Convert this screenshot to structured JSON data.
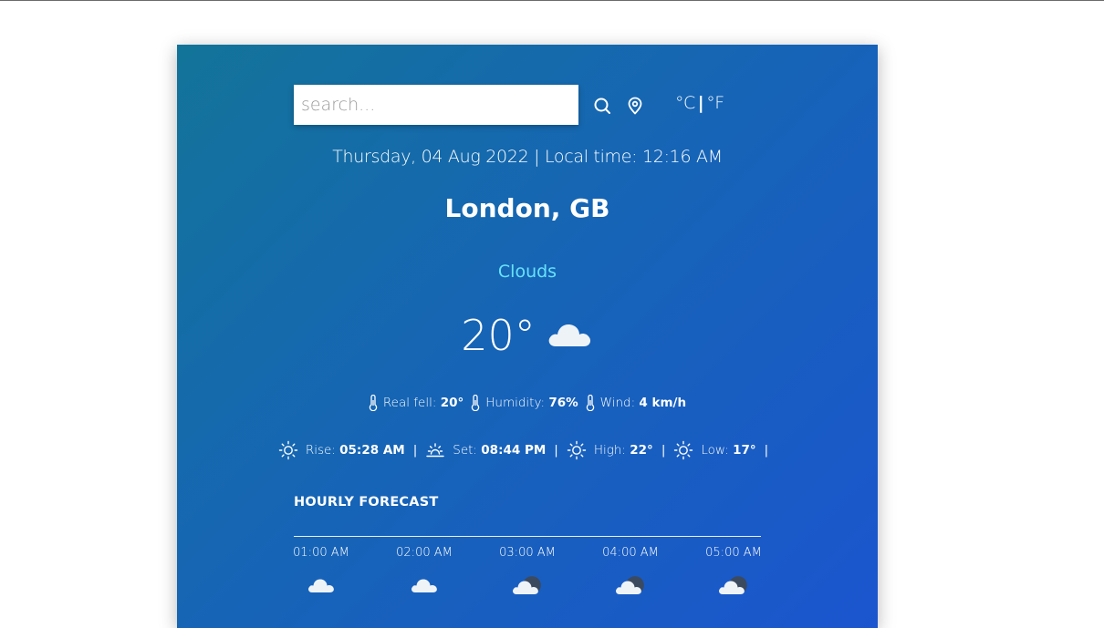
{
  "search": {
    "placeholder": "search..."
  },
  "units": {
    "celsius": "°C",
    "separator": "|",
    "fahrenheit": "°F"
  },
  "datetime": "Thursday, 04 Aug 2022 | Local time: 12:16 AM",
  "location": "London, GB",
  "condition": "Clouds",
  "temperature": "20°",
  "details": {
    "real_feel_label": "Real fell:",
    "real_feel_value": "20°",
    "humidity_label": "Humidity:",
    "humidity_value": "76%",
    "wind_label": "Wind:",
    "wind_value": "4 km/h"
  },
  "sun": {
    "rise_label": "Rise:",
    "rise_value": "05:28 AM",
    "set_label": "Set:",
    "set_value": "08:44 PM",
    "high_label": "High:",
    "high_value": "22°",
    "low_label": "Low:",
    "low_value": "17°",
    "separator": "|"
  },
  "hourly": {
    "title": "HOURLY FORECAST",
    "items": [
      {
        "time": "01:00 AM",
        "icon": "cloud-icon"
      },
      {
        "time": "02:00 AM",
        "icon": "cloud-icon"
      },
      {
        "time": "03:00 AM",
        "icon": "cloud-night-icon"
      },
      {
        "time": "04:00 AM",
        "icon": "cloud-night-icon"
      },
      {
        "time": "05:00 AM",
        "icon": "cloud-night-icon"
      }
    ]
  },
  "colors": {
    "gradient_start": "#137499",
    "gradient_end": "#1b55cf",
    "condition_text": "#67e2fb"
  }
}
